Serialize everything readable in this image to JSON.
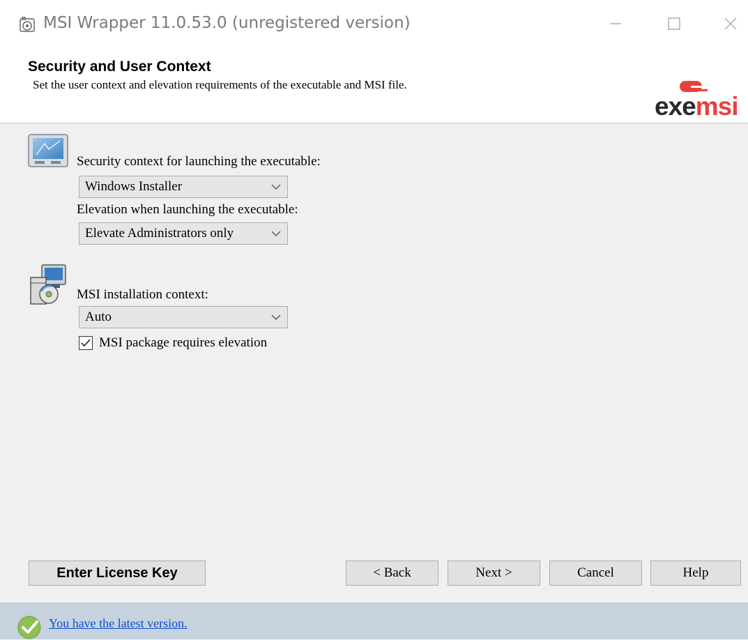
{
  "window": {
    "title": "MSI Wrapper 11.0.53.0 (unregistered version)",
    "controls": {
      "minimize": "—",
      "maximize": "☐",
      "close": "✕"
    }
  },
  "header": {
    "title": "Security and User Context",
    "subtitle": "Set the user context and elevation requirements of the executable and MSI file.",
    "logo": {
      "exe": "exe",
      "msi": "msi",
      "accent_color": "#e8413b"
    }
  },
  "executable": {
    "security_label": "Security context for launching the executable:",
    "security_value": "Windows Installer",
    "elevation_label": "Elevation when launching the executable:",
    "elevation_value": "Elevate Administrators only"
  },
  "msi": {
    "context_label": "MSI installation context:",
    "context_value": "Auto",
    "requires_elevation_label": "MSI package requires elevation",
    "requires_elevation_checked": true
  },
  "buttons": {
    "license": "Enter License Key",
    "back": "< Back",
    "next": "Next >",
    "cancel": "Cancel",
    "help": "Help"
  },
  "status": {
    "text": "You have the latest version.",
    "icon": "check-circle-icon",
    "link_color": "#0b4fd6"
  }
}
